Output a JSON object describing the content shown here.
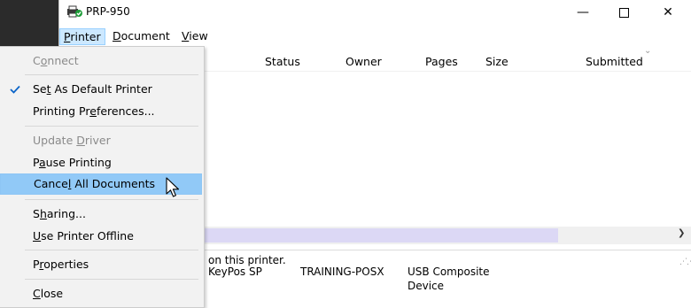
{
  "window": {
    "title": "PRP-950",
    "controls": {
      "minimize": "—",
      "close": "✕"
    }
  },
  "menubar": {
    "printer": {
      "pre": "",
      "u": "P",
      "post": "rinter"
    },
    "document": {
      "pre": "",
      "u": "D",
      "post": "ocument"
    },
    "view": {
      "pre": "",
      "u": "V",
      "post": "iew"
    }
  },
  "columns": {
    "status": "Status",
    "owner": "Owner",
    "pages": "Pages",
    "size": "Size",
    "submitted": "Submitted"
  },
  "status_text": "on this printer.",
  "background_row": {
    "name": "KeyPos SP",
    "owner": "TRAINING-POSX",
    "port_line1": "USB Composite",
    "port_line2": "Device"
  },
  "dropdown": {
    "connect": {
      "pre": "C",
      "u": "o",
      "post": "nnect"
    },
    "set_default": {
      "pre": "Se",
      "u": "t",
      "post": " As Default Printer"
    },
    "preferences": {
      "pre": "Printing Pr",
      "u": "e",
      "post": "ferences..."
    },
    "update_driver": {
      "pre": "Update ",
      "u": "D",
      "post": "river"
    },
    "pause": {
      "pre": "P",
      "u": "a",
      "post": "use Printing"
    },
    "cancel_all": {
      "pre": "Cance",
      "u": "l",
      "post": " All Documents"
    },
    "sharing": {
      "pre": "S",
      "u": "h",
      "post": "aring..."
    },
    "offline": {
      "pre": "",
      "u": "U",
      "post": "se Printer Offline"
    },
    "properties": {
      "pre": "P",
      "u": "r",
      "post": "operties"
    },
    "close": {
      "pre": "",
      "u": "C",
      "post": "lose"
    }
  },
  "colors": {
    "menu_highlight": "#91c9f7",
    "menubar_active": "#cce8ff",
    "check": "#0a64c8",
    "disabled_text": "#8a8a8a"
  }
}
